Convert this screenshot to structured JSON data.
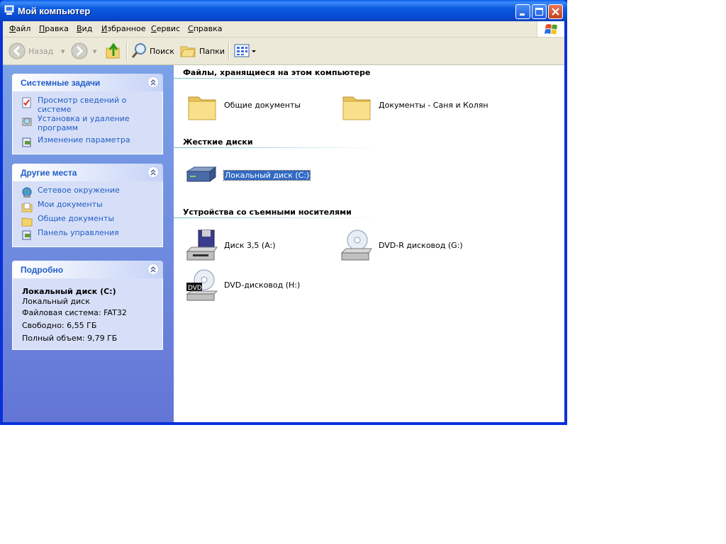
{
  "window": {
    "title": "Мой компьютер"
  },
  "menu": [
    {
      "label": "Файл",
      "accel": "Ф",
      "rest": "айл"
    },
    {
      "label": "Правка",
      "accel": "П",
      "rest": "равка"
    },
    {
      "label": "Вид",
      "accel": "В",
      "rest": "ид"
    },
    {
      "label": "Избранное",
      "accel": "И",
      "rest": "збранное"
    },
    {
      "label": "Сервис",
      "accel": "С",
      "rest": "ервис"
    },
    {
      "label": "Справка",
      "accel": "С",
      "rest": "правка"
    }
  ],
  "toolbar": {
    "back_label": "Назад",
    "search_label": "Поиск",
    "folders_label": "Папки"
  },
  "left": {
    "system_tasks": {
      "title": "Системные задачи",
      "items": [
        "Просмотр сведений о системе",
        "Установка и удаление программ",
        "Изменение параметра"
      ]
    },
    "other_places": {
      "title": "Другие места",
      "items": [
        "Сетевое окружение",
        "Мои документы",
        "Общие документы",
        "Панель управления"
      ]
    },
    "details": {
      "title": "Подробно",
      "name": "Локальный диск (C:)",
      "type": "Локальный диск",
      "fs": "Файловая система: FAT32",
      "free": "Свободно: 6,55 ГБ",
      "total": "Полный объем: 9,79 ГБ"
    }
  },
  "groups": {
    "files": {
      "title": "Файлы, хранящиеся на этом компьютере",
      "items": [
        "Общие документы",
        "Документы - Саня и Колян"
      ]
    },
    "hard_drives": {
      "title": "Жесткие диски",
      "items": [
        "Локальный диск (C:)"
      ]
    },
    "removable": {
      "title": "Устройства со съемными носителями",
      "items": [
        "Диск 3,5 (A:)",
        "DVD-R дисковод (G:)",
        "DVD-дисковод (H:)"
      ]
    }
  },
  "colors": {
    "titlebar": "#0a5ae0",
    "task_link": "#215dc6",
    "selection": "#316ac5"
  }
}
